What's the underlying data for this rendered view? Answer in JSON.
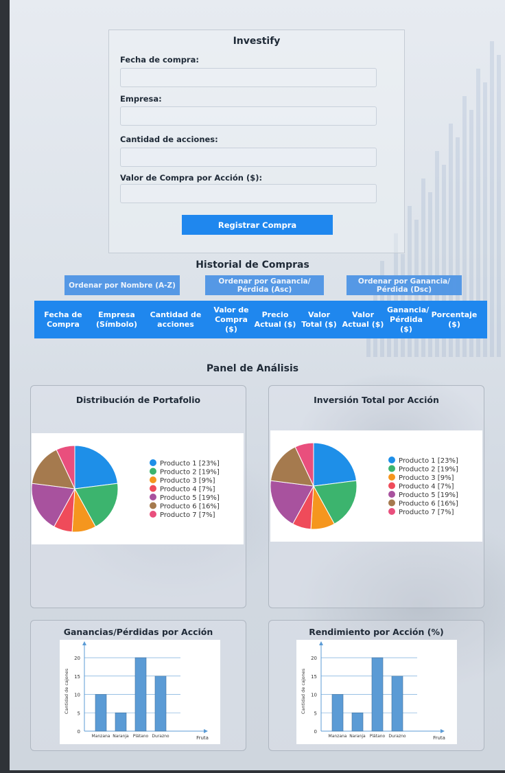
{
  "form": {
    "title": "Investify",
    "fields": [
      {
        "label": "Fecha de compra:",
        "value": "",
        "placeholder": ""
      },
      {
        "label": "Empresa:",
        "value": "",
        "placeholder": ""
      },
      {
        "label": "Cantidad de acciones:",
        "value": "",
        "placeholder": ""
      },
      {
        "label": "Valor de Compra por Acción ($):",
        "value": "",
        "placeholder": ""
      }
    ],
    "submit_label": "Registrar Compra"
  },
  "history": {
    "title": "Historial de Compras",
    "sort_buttons": [
      "Ordenar por Nombre (A-Z)",
      "Ordenar por Ganancia/ Pérdida (Asc)",
      "Ordenar por Ganancia/ Pérdida (Dsc)"
    ],
    "columns": [
      "Fecha de Compra",
      "Empresa (Símbolo)",
      "Cantidad de acciones",
      "Valor de Compra ($)",
      "Precio Actual ($)",
      "Valor Total ($)",
      "Valor Actual ($)",
      "Ganancia/ Pérdida ($)",
      "Porcentaje ($)"
    ]
  },
  "analysis": {
    "title": "Panel de Análisis",
    "panels": [
      "Distribución de Portafolio",
      "Inversión Total por Acción",
      "Ganancias/Pérdidas por Acción",
      "Rendimiento por Acción (%)"
    ]
  },
  "colors": {
    "primary": "#1f87ee",
    "sort_button": "#4e95e5"
  },
  "chart_data": [
    {
      "type": "pie",
      "title": "",
      "categories": [
        "Producto 1",
        "Producto 2",
        "Producto 3",
        "Producto 4",
        "Producto 5",
        "Producto 6",
        "Producto 7"
      ],
      "values": [
        23,
        19,
        9,
        7,
        19,
        16,
        7
      ],
      "legend": [
        "Producto 1 [23%]",
        "Producto 2 [19%]",
        "Producto 3 [9%]",
        "Producto 4 [7%]",
        "Producto 5 [19%]",
        "Producto 6 [16%]",
        "Producto 7 [7%]"
      ],
      "colors": [
        "#1e8fe8",
        "#3cb46e",
        "#f5961e",
        "#ef4b5a",
        "#a8529e",
        "#a57a4e",
        "#e94f7d"
      ],
      "legend_position": "right"
    },
    {
      "type": "pie",
      "title": "",
      "categories": [
        "Producto 1",
        "Producto 2",
        "Producto 3",
        "Producto 4",
        "Producto 5",
        "Producto 6",
        "Producto 7"
      ],
      "values": [
        23,
        19,
        9,
        7,
        19,
        16,
        7
      ],
      "legend": [
        "Producto 1 [23%]",
        "Producto 2 [19%]",
        "Producto 3 [9%]",
        "Producto 4 [7%]",
        "Producto 5 [19%]",
        "Producto 6 [16%]",
        "Producto 7 [7%]"
      ],
      "colors": [
        "#1e8fe8",
        "#3cb46e",
        "#f5961e",
        "#ef4b5a",
        "#a8529e",
        "#a57a4e",
        "#e94f7d"
      ],
      "legend_position": "right"
    },
    {
      "type": "bar",
      "title": "",
      "categories": [
        "Manzana",
        "Naranja",
        "Plátano",
        "Durazno"
      ],
      "values": [
        10,
        5,
        20,
        15
      ],
      "xlabel": "Fruta",
      "ylabel": "Cantidad de cajones",
      "yticks": [
        0,
        5,
        10,
        15,
        20
      ],
      "ylim": [
        0,
        23
      ],
      "grid": true,
      "bar_color": "#5b9bd5"
    },
    {
      "type": "bar",
      "title": "",
      "categories": [
        "Manzana",
        "Naranja",
        "Plátano",
        "Durazno"
      ],
      "values": [
        10,
        5,
        20,
        15
      ],
      "xlabel": "Fruta",
      "ylabel": "Cantidad de cajones",
      "yticks": [
        0,
        5,
        10,
        15,
        20
      ],
      "ylim": [
        0,
        23
      ],
      "grid": true,
      "bar_color": "#5b9bd5"
    }
  ]
}
